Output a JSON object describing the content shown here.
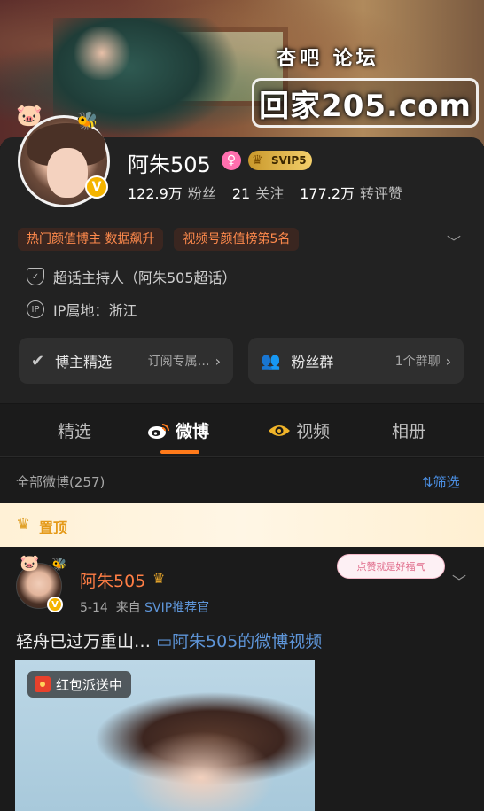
{
  "cover": {
    "watermark_top": "杏吧 论坛",
    "watermark_main": "回家205.com"
  },
  "profile": {
    "name": "阿朱505",
    "svip_level": "SVIP5",
    "verified_badge": "V",
    "stats": [
      {
        "value": "122.9万",
        "label": "粉丝"
      },
      {
        "value": "21",
        "label": "关注"
      },
      {
        "value": "177.2万",
        "label": "转评赞"
      }
    ],
    "tags": [
      "热门颜值博主 数据飙升",
      "视频号颜值榜第5名"
    ],
    "info": {
      "super_topic": "超话主持人（阿朱505超话）",
      "ip_location": "IP属地：浙江"
    },
    "features": [
      {
        "label": "博主精选",
        "sub": "订阅专属…"
      },
      {
        "label": "粉丝群",
        "sub": "1个群聊"
      }
    ]
  },
  "tabs": [
    {
      "label": "精选",
      "active": false
    },
    {
      "label": "微博",
      "active": true
    },
    {
      "label": "视频",
      "active": false
    },
    {
      "label": "相册",
      "active": false
    }
  ],
  "filter": {
    "all_posts": "全部微博(257)",
    "filter_label": "筛选"
  },
  "pinned": {
    "label": "置顶"
  },
  "post": {
    "author": "阿朱505",
    "date": "5-14",
    "source_prefix": "来自",
    "source": "SVIP推荐官",
    "sticker_text": "点赞就是好福气",
    "text": "轻舟已过万重山…",
    "link_text": "阿朱505的微博视频",
    "media_badge": "红包派送中"
  },
  "colors": {
    "accent_orange": "#ff7a1a",
    "link_blue": "#5e95d8",
    "tag_text": "#ff8a4c",
    "background": "#1b1b1b"
  },
  "icons": [
    "pig-icon",
    "bee-icon",
    "female-icon",
    "crown-icon",
    "shield-icon",
    "ip-icon",
    "chevron-down-icon",
    "chevron-right-icon",
    "weibo-logo-icon",
    "video-eye-icon",
    "filter-icon",
    "more-icon",
    "red-packet-icon",
    "group-icon",
    "select-icon"
  ]
}
